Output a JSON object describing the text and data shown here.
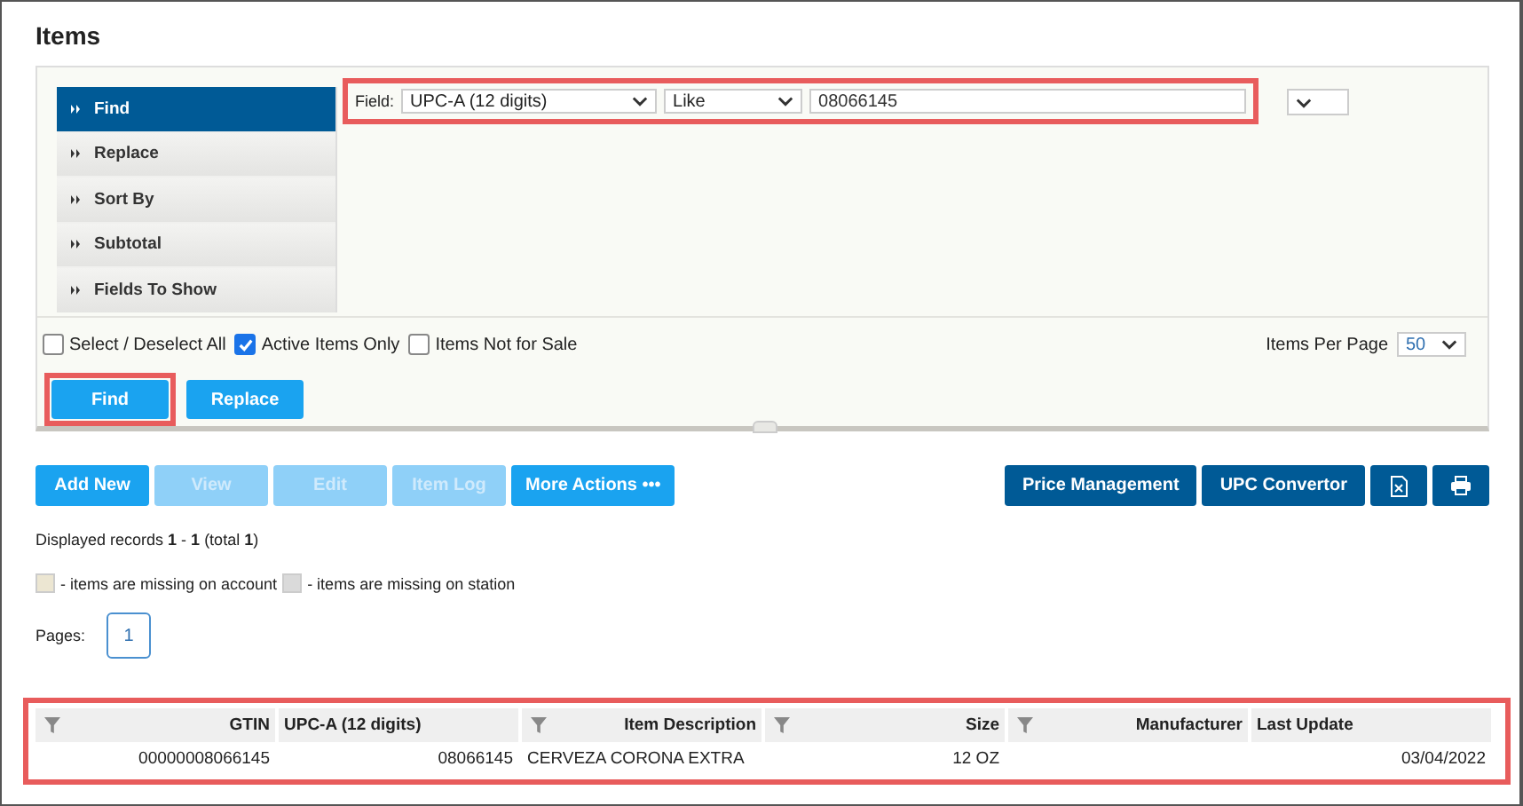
{
  "title": "Items",
  "menu": [
    {
      "label": "Find",
      "selected": true
    },
    {
      "label": "Replace",
      "selected": false
    },
    {
      "label": "Sort By",
      "selected": false
    },
    {
      "label": "Subtotal",
      "selected": false
    },
    {
      "label": "Fields To Show",
      "selected": false
    }
  ],
  "search": {
    "label": "Field:",
    "field": "UPC-A (12 digits)",
    "operator": "Like",
    "value": "08066145",
    "highlighted": true
  },
  "options": [
    {
      "label": "Select / Deselect All",
      "checked": false
    },
    {
      "label": "Active Items Only",
      "checked": true
    },
    {
      "label": "Items Not for Sale",
      "checked": false
    }
  ],
  "per_page": {
    "label": "Items Per Page",
    "value": "50"
  },
  "form_buttons": [
    {
      "label": "Find",
      "highlighted": true
    },
    {
      "label": "Replace",
      "highlighted": false
    }
  ],
  "actions": [
    {
      "label": "Add New",
      "disabled": false
    },
    {
      "label": "View",
      "disabled": true
    },
    {
      "label": "Edit",
      "disabled": true
    },
    {
      "label": "Item Log",
      "disabled": true
    },
    {
      "label": "More Actions •••",
      "disabled": false
    }
  ],
  "tools": [
    {
      "kind": "text",
      "label": "Price Management"
    },
    {
      "kind": "text",
      "label": "UPC Convertor"
    },
    {
      "kind": "spreadsheet"
    },
    {
      "kind": "print"
    }
  ],
  "records": "Displayed records **1** - **1** (total **1**)",
  "legend": [
    {
      "color": "#ece6d2",
      "label": "- items are missing on account"
    },
    {
      "color": "#dadada",
      "label": "- items are missing on station"
    }
  ],
  "pages_label": "Pages:",
  "pages": [
    "1"
  ],
  "table": {
    "highlighted": true,
    "columns": [
      {
        "label": "GTIN",
        "filter": true,
        "kind": "number"
      },
      {
        "label": "UPC-A (12 digits)",
        "filter": false,
        "kind": "number"
      },
      {
        "label": "Item Description",
        "filter": true,
        "kind": "text"
      },
      {
        "label": "Size",
        "filter": true,
        "kind": "number"
      },
      {
        "label": "Manufacturer",
        "filter": true,
        "kind": "text"
      },
      {
        "label": "Last Update",
        "filter": false,
        "kind": "number"
      }
    ],
    "rows": [
      [
        "00000008066145",
        "08066145",
        "CERVEZA CORONA EXTRA",
        "12 OZ",
        null,
        "03/04/2022"
      ]
    ]
  }
}
